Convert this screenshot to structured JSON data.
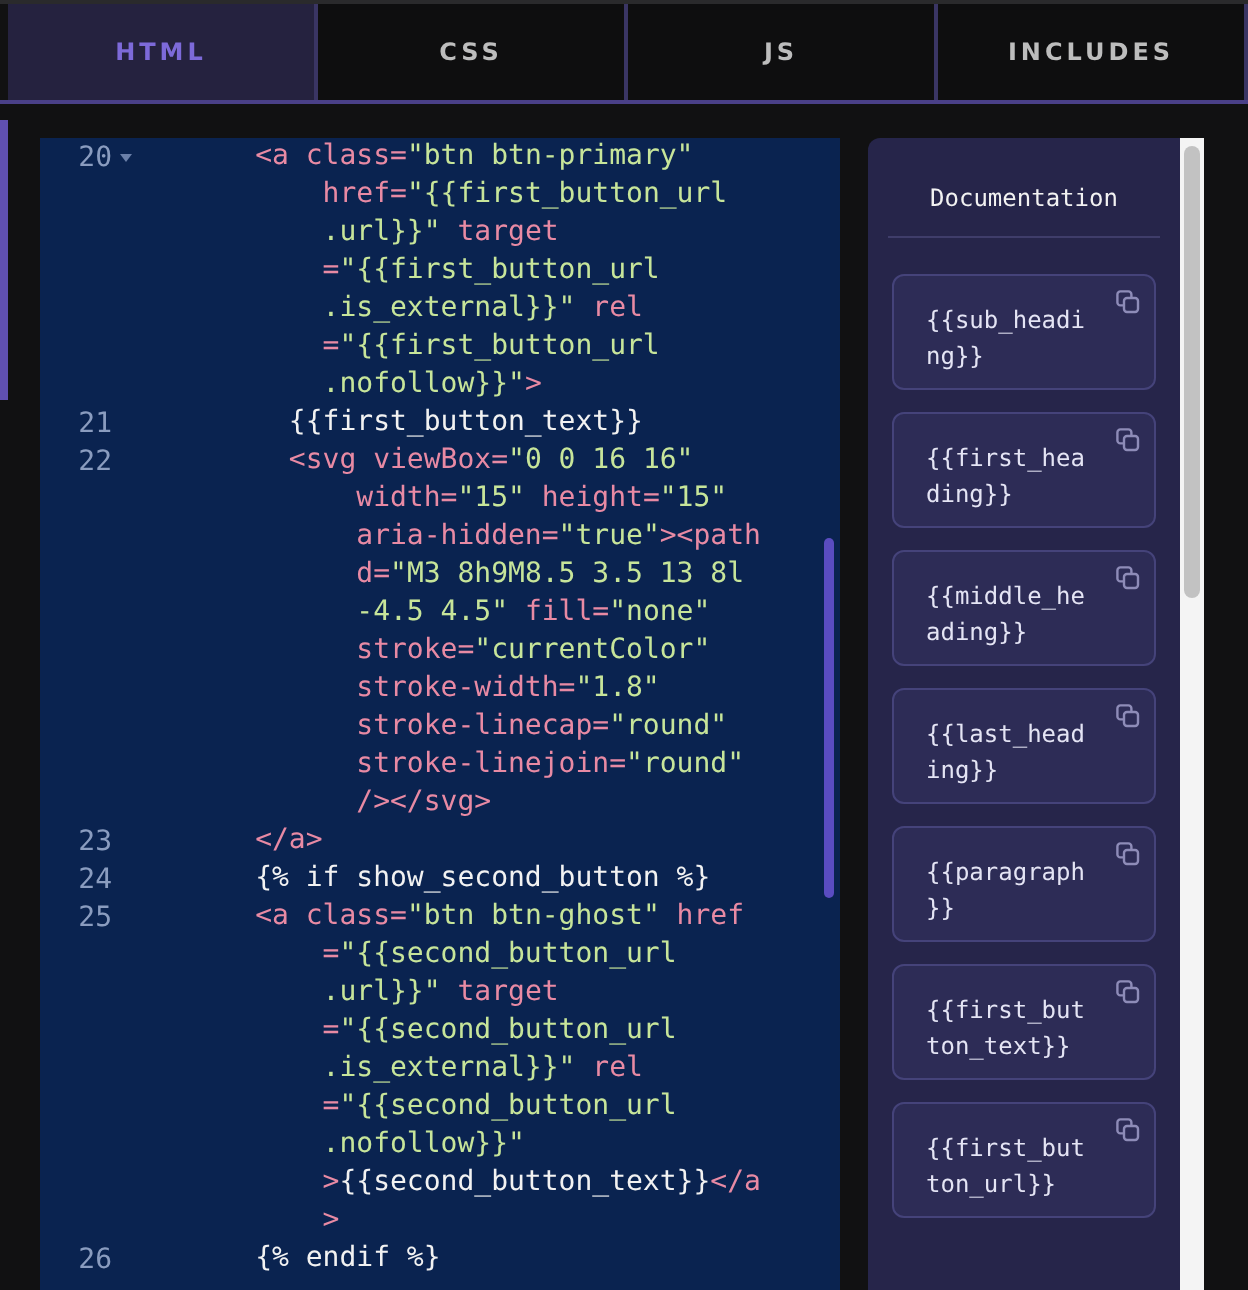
{
  "tabs": [
    {
      "label": "HTML",
      "selected": true
    },
    {
      "label": "CSS",
      "selected": false
    },
    {
      "label": "JS",
      "selected": false
    },
    {
      "label": "INCLUDES",
      "selected": false
    }
  ],
  "editor": {
    "lines": [
      {
        "number": "20",
        "foldable": true,
        "rows": [
          [
            {
              "kind": "markup",
              "text": "      <a class="
            },
            {
              "kind": "string",
              "text": "\"btn btn-primary\""
            }
          ],
          [
            {
              "kind": "markup",
              "text": "          href="
            },
            {
              "kind": "string",
              "text": "\"{{first_button_url"
            }
          ],
          [
            {
              "kind": "string",
              "text": "          .url}}\""
            },
            {
              "kind": "markup",
              "text": " target"
            }
          ],
          [
            {
              "kind": "markup",
              "text": "          ="
            },
            {
              "kind": "string",
              "text": "\"{{first_button_url"
            }
          ],
          [
            {
              "kind": "string",
              "text": "          .is_external}}\""
            },
            {
              "kind": "markup",
              "text": " rel"
            }
          ],
          [
            {
              "kind": "markup",
              "text": "          ="
            },
            {
              "kind": "string",
              "text": "\"{{first_button_url"
            }
          ],
          [
            {
              "kind": "string",
              "text": "          .nofollow}}\""
            },
            {
              "kind": "markup",
              "text": ">"
            }
          ]
        ]
      },
      {
        "number": "21",
        "foldable": false,
        "rows": [
          [
            {
              "kind": "text",
              "text": "        {{first_button_text}}"
            }
          ]
        ]
      },
      {
        "number": "22",
        "foldable": false,
        "rows": [
          [
            {
              "kind": "markup",
              "text": "        <svg viewBox="
            },
            {
              "kind": "string",
              "text": "\"0 0 16 16\""
            }
          ],
          [
            {
              "kind": "markup",
              "text": "            width="
            },
            {
              "kind": "string",
              "text": "\"15\""
            },
            {
              "kind": "markup",
              "text": " height="
            },
            {
              "kind": "string",
              "text": "\"15\""
            }
          ],
          [
            {
              "kind": "markup",
              "text": "            aria-hidden="
            },
            {
              "kind": "string",
              "text": "\"true\""
            },
            {
              "kind": "markup",
              "text": "><path"
            }
          ],
          [
            {
              "kind": "markup",
              "text": "            d="
            },
            {
              "kind": "string",
              "text": "\"M3 8h9M8.5 3.5 13 8l"
            }
          ],
          [
            {
              "kind": "string",
              "text": "            -4.5 4.5\""
            },
            {
              "kind": "markup",
              "text": " fill="
            },
            {
              "kind": "string",
              "text": "\"none\""
            }
          ],
          [
            {
              "kind": "markup",
              "text": "            stroke="
            },
            {
              "kind": "string",
              "text": "\"currentColor\""
            }
          ],
          [
            {
              "kind": "markup",
              "text": "            stroke-width="
            },
            {
              "kind": "string",
              "text": "\"1.8\""
            }
          ],
          [
            {
              "kind": "markup",
              "text": "            stroke-linecap="
            },
            {
              "kind": "string",
              "text": "\"round\""
            }
          ],
          [
            {
              "kind": "markup",
              "text": "            stroke-linejoin="
            },
            {
              "kind": "string",
              "text": "\"round\""
            }
          ],
          [
            {
              "kind": "markup",
              "text": "            /></svg>"
            }
          ]
        ]
      },
      {
        "number": "23",
        "foldable": false,
        "rows": [
          [
            {
              "kind": "markup",
              "text": "      </a>"
            }
          ]
        ]
      },
      {
        "number": "24",
        "foldable": false,
        "rows": [
          [
            {
              "kind": "text",
              "text": "      {% if show_second_button %}"
            }
          ]
        ]
      },
      {
        "number": "25",
        "foldable": false,
        "rows": [
          [
            {
              "kind": "markup",
              "text": "      <a class="
            },
            {
              "kind": "string",
              "text": "\"btn btn-ghost\""
            },
            {
              "kind": "markup",
              "text": " href"
            }
          ],
          [
            {
              "kind": "markup",
              "text": "          ="
            },
            {
              "kind": "string",
              "text": "\"{{second_button_url"
            }
          ],
          [
            {
              "kind": "string",
              "text": "          .url}}\""
            },
            {
              "kind": "markup",
              "text": " target"
            }
          ],
          [
            {
              "kind": "markup",
              "text": "          ="
            },
            {
              "kind": "string",
              "text": "\"{{second_button_url"
            }
          ],
          [
            {
              "kind": "string",
              "text": "          .is_external}}\""
            },
            {
              "kind": "markup",
              "text": " rel"
            }
          ],
          [
            {
              "kind": "markup",
              "text": "          ="
            },
            {
              "kind": "string",
              "text": "\"{{second_button_url"
            }
          ],
          [
            {
              "kind": "string",
              "text": "          .nofollow}}\""
            }
          ],
          [
            {
              "kind": "markup",
              "text": "          >"
            },
            {
              "kind": "text",
              "text": "{{second_button_text}}"
            },
            {
              "kind": "markup",
              "text": "</a"
            }
          ],
          [
            {
              "kind": "markup",
              "text": "          >"
            }
          ]
        ]
      },
      {
        "number": "26",
        "foldable": false,
        "rows": [
          [
            {
              "kind": "text",
              "text": "      {% endif %}"
            }
          ]
        ]
      }
    ]
  },
  "documentation": {
    "title": "Documentation",
    "variables": [
      "{{sub_heading}}",
      "{{first_heading}}",
      "{{middle_heading}}",
      "{{last_heading}}",
      "{{paragraph}}",
      "{{first_button_text}}",
      "{{first_button_url}}"
    ]
  }
}
